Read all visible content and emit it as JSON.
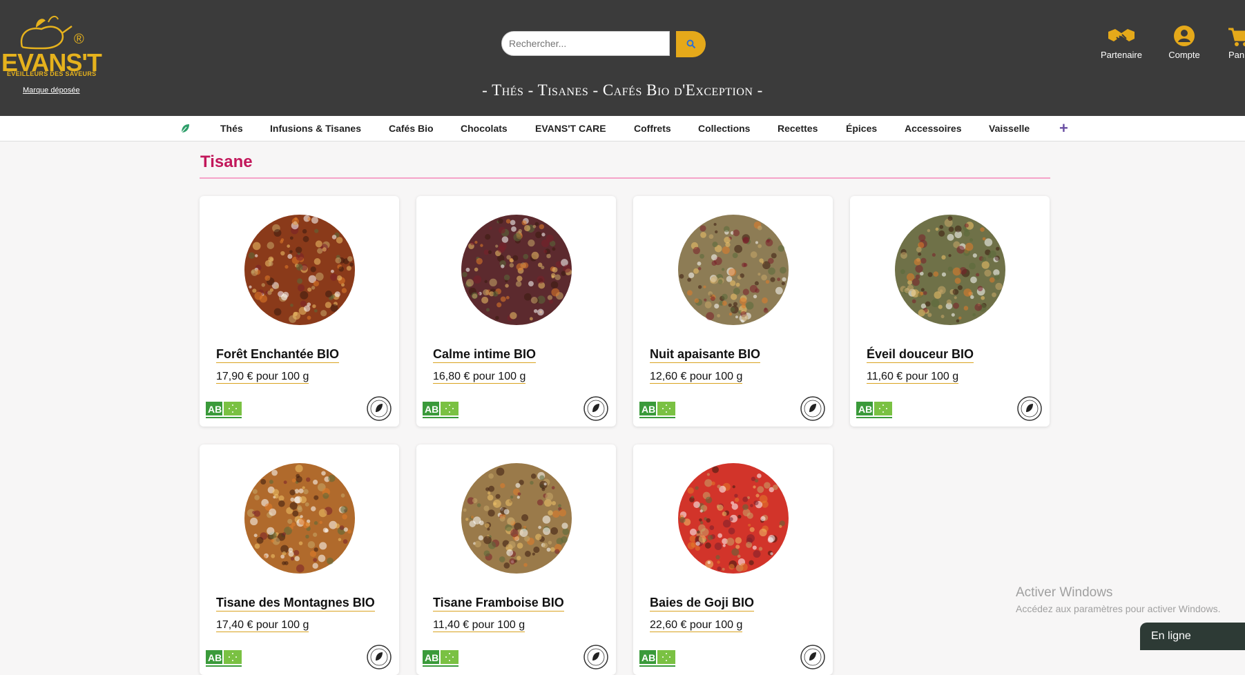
{
  "brand": {
    "name": "EVANS'T",
    "registered": "®",
    "tagline": "ÉVEILLEURS DES SAVEURS",
    "trademark_link": "Marque déposée",
    "gold": "#e6b21d"
  },
  "search": {
    "placeholder": "Rechercher..."
  },
  "header_tagline": "- Thés - Tisanes - Cafés Bio d'Exception -",
  "header_links": [
    {
      "label": "Partenaire",
      "icon": "handshake-icon"
    },
    {
      "label": "Compte",
      "icon": "account-icon"
    },
    {
      "label": "Pani",
      "icon": "cart-icon"
    }
  ],
  "nav": {
    "items": [
      "Thés",
      "Infusions & Tisanes",
      "Cafés Bio",
      "Chocolats",
      "EVANS'T CARE",
      "Coffrets",
      "Collections",
      "Recettes",
      "Épices",
      "Accessoires",
      "Vaisselle"
    ],
    "more": "+"
  },
  "page_title": "Tisane",
  "products": [
    {
      "name": "Forêt Enchantée BIO",
      "price": "17,90 € pour 100 g",
      "color": "#8a3a1a"
    },
    {
      "name": "Calme intime BIO",
      "price": "16,80 € pour 100 g",
      "color": "#5c2a2e"
    },
    {
      "name": "Nuit apaisante BIO",
      "price": "12,60 € pour 100 g",
      "color": "#8d7c55"
    },
    {
      "name": "Éveil douceur BIO",
      "price": "11,60 € pour 100 g",
      "color": "#6f7148"
    },
    {
      "name": "Tisane des Montagnes BIO",
      "price": "17,40 € pour 100 g",
      "color": "#b06a2c"
    },
    {
      "name": "Tisane Framboise BIO",
      "price": "11,40 € pour 100 g",
      "color": "#9a7a4a"
    },
    {
      "name": "Baies de Goji BIO",
      "price": "22,60 € pour 100 g",
      "color": "#d2342a"
    }
  ],
  "labels": {
    "ab": "AB"
  },
  "windows": {
    "title": "Activer Windows",
    "subtitle": "Accédez aux paramètres pour activer Windows."
  },
  "chat": {
    "label": "En ligne"
  }
}
